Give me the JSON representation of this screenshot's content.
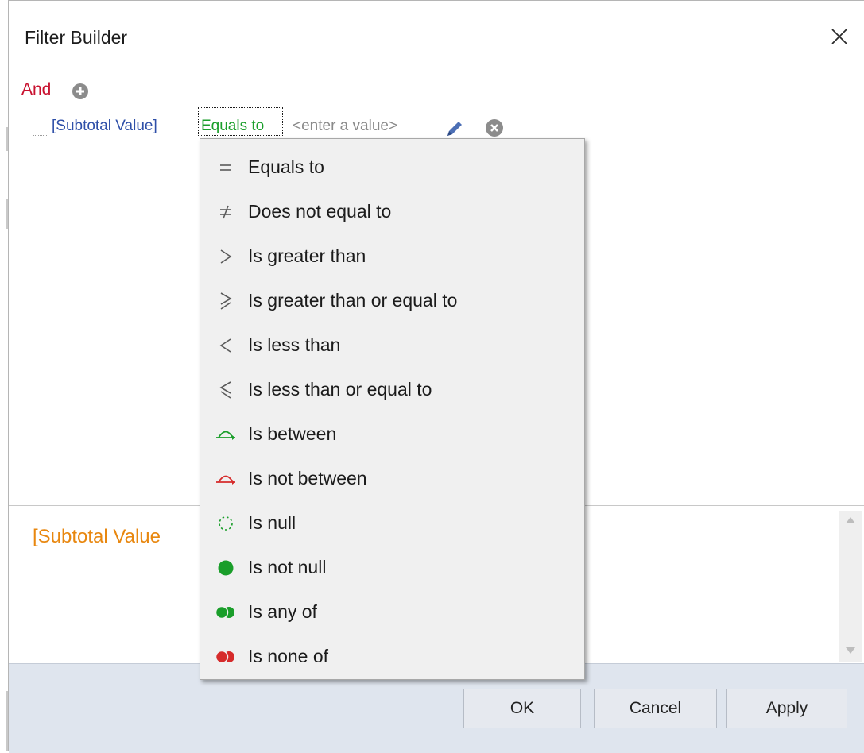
{
  "dialog": {
    "title": "Filter Builder",
    "close_icon": "close-icon"
  },
  "condition": {
    "group_operator": "And",
    "add_icon": "add-condition-icon",
    "field": "[Subtotal Value]",
    "operator": "Equals to",
    "value_placeholder": "<enter a value>",
    "edit_icon": "pencil-icon",
    "remove_icon": "remove-condition-icon"
  },
  "operator_menu": {
    "items": [
      {
        "label": "Equals to",
        "icon": "equals-icon"
      },
      {
        "label": "Does not equal to",
        "icon": "not-equal-icon"
      },
      {
        "label": "Is greater than",
        "icon": "greater-than-icon"
      },
      {
        "label": "Is greater than or equal to",
        "icon": "greater-or-equal-icon"
      },
      {
        "label": "Is less than",
        "icon": "less-than-icon"
      },
      {
        "label": "Is less than or equal to",
        "icon": "less-or-equal-icon"
      },
      {
        "label": "Is between",
        "icon": "between-icon"
      },
      {
        "label": "Is not between",
        "icon": "not-between-icon"
      },
      {
        "label": "Is null",
        "icon": "null-icon"
      },
      {
        "label": "Is not null",
        "icon": "not-null-icon"
      },
      {
        "label": "Is any of",
        "icon": "any-of-icon"
      },
      {
        "label": "Is none of",
        "icon": "none-of-icon"
      }
    ]
  },
  "expression": {
    "text": "[Subtotal Value"
  },
  "buttons": {
    "ok": "OK",
    "cancel": "Cancel",
    "apply": "Apply"
  },
  "colors": {
    "group_operator": "#c8102e",
    "field": "#2e4fa8",
    "operator": "#1a9e2a",
    "placeholder": "#8a8a8a",
    "expression": "#e8870f",
    "green": "#1a9e2a",
    "red": "#d62b2b"
  }
}
